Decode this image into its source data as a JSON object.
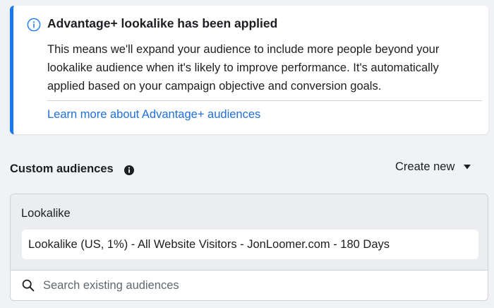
{
  "notice": {
    "title": "Advantage+ lookalike has been applied",
    "body": "This means we'll expand your audience to include more people beyond your lookalike audience when it's likely to improve performance. It's automatically applied based on your campaign objective and conversion goals.",
    "link": "Learn more about Advantage+ audiences",
    "icon": "info-circle-icon",
    "accent_color": "#1877f2",
    "link_color": "#216fdb"
  },
  "custom_audiences": {
    "title": "Custom audiences",
    "info_icon": "info-filled-icon",
    "create_new": "Create new",
    "group_label": "Lookalike",
    "selected_audience": "Lookalike (US, 1%) - All Website Visitors - JonLoomer.com - 180 Days",
    "search_placeholder": "Search existing audiences"
  }
}
